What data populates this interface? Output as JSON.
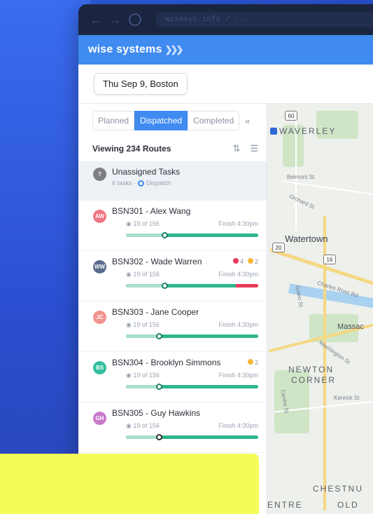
{
  "browser": {
    "url": "wisesys.info / ..."
  },
  "app": {
    "brand": "wise systems",
    "brand_chevrons": "❯❯❯"
  },
  "date_chip": "Thu Sep 9, Boston",
  "tabs": [
    "Planned",
    "Dispatched",
    "Completed"
  ],
  "active_tab": "Dispatched",
  "viewing": "Viewing 234 Routes",
  "unassigned": {
    "title": "Unassigned Tasks",
    "tasks": "6 tasks ·",
    "status": "Dispatch"
  },
  "routes": [
    {
      "initials": "AW",
      "title": "BSN301 - Alex Wang",
      "progress": "19 of 156",
      "finish": "Finish 4:30pm",
      "color": "#f07683",
      "done_fraction": 0.29,
      "warn_fraction": 0,
      "badges": []
    },
    {
      "initials": "WW",
      "title": "BSN302 - Wade Warren",
      "progress": "19 of 156",
      "finish": "Finish 4:30pm",
      "color": "#5a6b8c",
      "done_fraction": 0.29,
      "warn_fraction": 0.17,
      "badges": [
        {
          "color": "#ea3b5a",
          "count": "4"
        },
        {
          "color": "#f5b73b",
          "count": "2"
        }
      ]
    },
    {
      "initials": "JC",
      "title": "BSN303 - Jane Cooper",
      "progress": "19 of 156",
      "finish": "Finish 4:30pm",
      "color": "#f3938f",
      "done_fraction": 0.25,
      "warn_fraction": 0,
      "badges": []
    },
    {
      "initials": "BS",
      "title": "BSN304 - Brooklyn Simmons",
      "progress": "19 of 156",
      "finish": "Finish 4:30pm",
      "color": "#34bfa0",
      "done_fraction": 0.25,
      "warn_fraction": 0,
      "badges": [
        {
          "color": "#f5b73b",
          "count": "2"
        }
      ]
    },
    {
      "initials": "GH",
      "title": "BSN305 - Guy Hawkins",
      "progress": "19 of 156",
      "finish": "Finish 4:30pm",
      "color": "#c77ac9",
      "done_fraction": 0.25,
      "warn_fraction": 0,
      "badges": []
    }
  ],
  "map": {
    "labels": {
      "waverley": "WAVERLEY",
      "watertown": "Watertown",
      "massac": "Massac",
      "newton1": "NEWTON",
      "newton2": "CORNER",
      "chestnut": "CHESTNU",
      "entre": "ENTRE",
      "old": "OLD",
      "r60": "60",
      "r20": "20",
      "r16": "16",
      "orchard": "Orchard St",
      "belmont": "Belmont St",
      "charles": "Charles River Rd",
      "washington": "Washington St",
      "galen": "Galen St",
      "kenrick": "Kenrick St",
      "centre": "Centre St"
    }
  }
}
